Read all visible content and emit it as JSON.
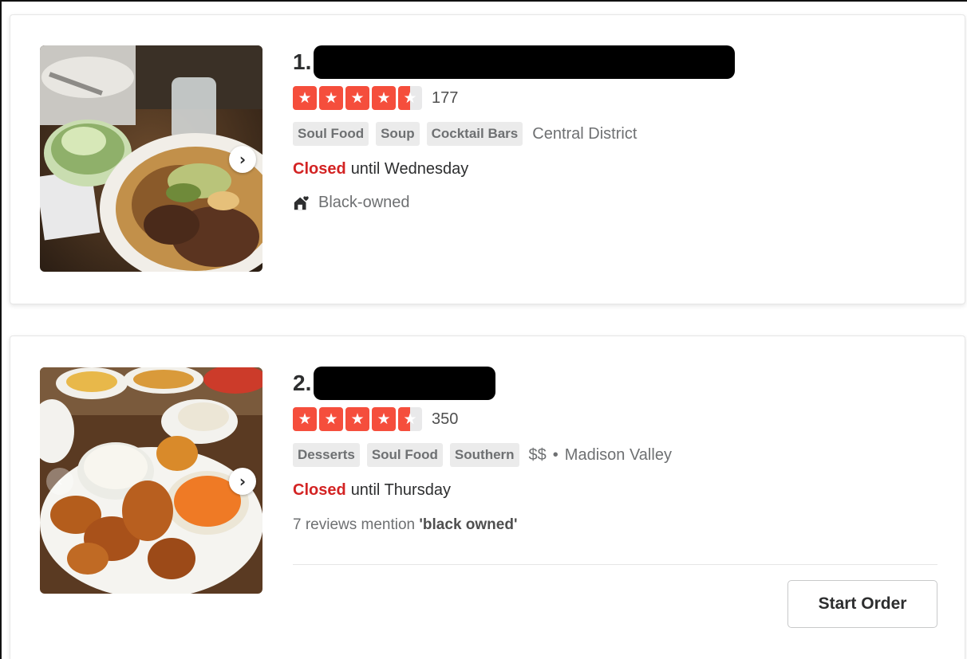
{
  "results": [
    {
      "rank": "1.",
      "rating": 4.5,
      "review_count": "177",
      "categories": [
        "Soul Food",
        "Soup",
        "Cocktail Bars"
      ],
      "neighborhood": "Central District",
      "status": {
        "state": "Closed",
        "until": "until Wednesday"
      },
      "attribute": {
        "icon": "black-owned-icon",
        "label": "Black-owned"
      },
      "photo_icon": "food-photo"
    },
    {
      "rank": "2.",
      "rating": 4.5,
      "review_count": "350",
      "categories": [
        "Desserts",
        "Soul Food",
        "Southern"
      ],
      "price": "$$",
      "separator": "•",
      "neighborhood": "Madison Valley",
      "status": {
        "state": "Closed",
        "until": "until Thursday"
      },
      "mention": {
        "prefix": "7 reviews mention ",
        "quote": "'black owned'"
      },
      "action_button": "Start Order",
      "photo_icon": "food-photo"
    }
  ],
  "colors": {
    "star_red": "#f54e3c",
    "closed_red": "#d32323",
    "tag_bg": "#ebebeb"
  }
}
